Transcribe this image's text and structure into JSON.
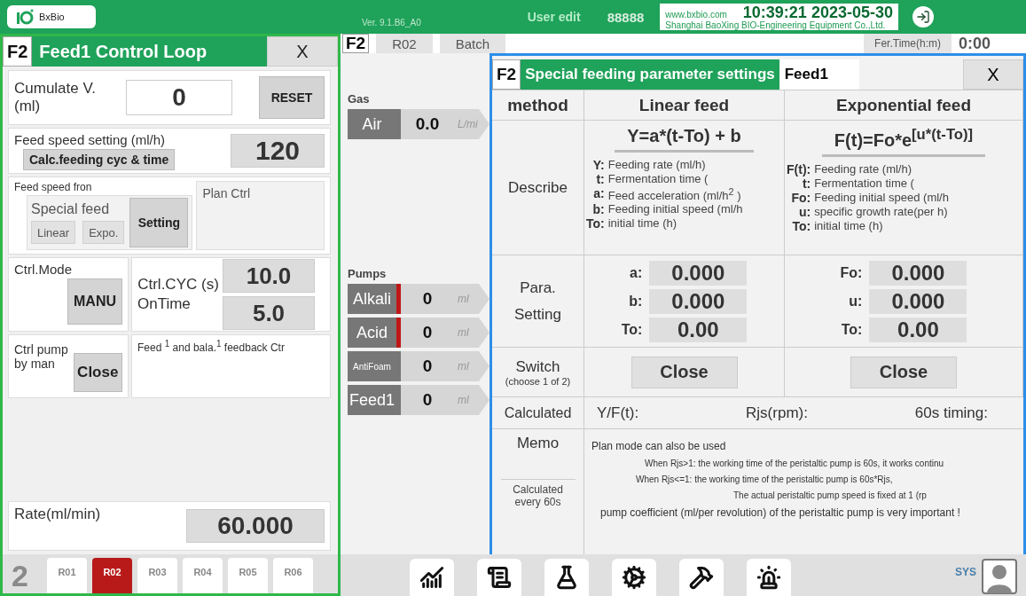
{
  "top_bar": {
    "brand": "BxBio",
    "version": "Ver. 9.1.B6_A0",
    "user": "User edit",
    "code": "88888",
    "website": "www.bxbio.com",
    "company": "Shanghai BaoXing BIO-Engineering Equipment Co.,Ltd.",
    "clock": "10:39:21 2023-05-30"
  },
  "feed_dialog": {
    "tag": "F2",
    "title": "Feed1 Control Loop",
    "close": "X",
    "cumulate": {
      "label": "Cumulate V. (ml)",
      "value": "0",
      "button": "RESET"
    },
    "speed": {
      "label": "Feed speed setting (ml/h)",
      "button": "Calc.feeding cyc & time",
      "value": "120"
    },
    "source": {
      "label": "Feed speed fron",
      "group": "Special feed",
      "options": [
        {
          "label": "Linear",
          "selected": false
        },
        {
          "label": "Expo.",
          "selected": false
        }
      ],
      "button": "Setting",
      "plan": "Plan Ctrl"
    },
    "mode": {
      "label": "Ctrl.Mode",
      "button": "MANU",
      "cycle_label": "Ctrl.CYC (s)",
      "cycle": "10.0",
      "ontime_label": "OnTime",
      "ontime": "5.0"
    },
    "manual": {
      "label": "Ctrl pump by man",
      "button": "Close",
      "feedback": "Feed $^{1}$ and bala.$^{1}$ feedback Ctr"
    },
    "rate": {
      "label": "Rate(ml/min)",
      "value": "60.000"
    }
  },
  "middle": {
    "tag": "F2",
    "tabs": [
      "R02",
      "Batch"
    ],
    "timer_label": "Fer.Time(h:m)",
    "timer": "0:00",
    "gas": {
      "title": "Gas",
      "rows": [
        {
          "label": "Air",
          "value": "0.0",
          "unit": "L/mi",
          "on": false
        }
      ]
    },
    "pumps": {
      "title": "Pumps",
      "rows": [
        {
          "label": "Alkali",
          "value": "0",
          "unit": "ml",
          "on": true
        },
        {
          "label": "Acid",
          "value": "0",
          "unit": "ml",
          "on": true
        },
        {
          "label": "AntiFoam",
          "value": "0",
          "unit": "ml",
          "on": false
        },
        {
          "label": "Feed1",
          "value": "0",
          "unit": "ml",
          "on": false
        }
      ]
    }
  },
  "special_dialog": {
    "tag": "F2",
    "title": "Special feeding parameter settings",
    "feed": "Feed1",
    "close": "X",
    "method_label": "method",
    "describe_label": "Describe",
    "para_label": "Para. Setting",
    "switch_label": "Switch",
    "switch_hint": "(choose 1 of 2)",
    "calc_label": "Calculated",
    "methods": [
      {
        "name": "Linear feed",
        "formula": "Y=a*(t-To) + b",
        "terms": [
          {
            "key": "Y:",
            "text": "Feeding rate (ml/h)"
          },
          {
            "key": "t:",
            "text": "Fermentation time ("
          },
          {
            "key": "a:",
            "text": "Feed acceleration (ml/h$^{2}$ )"
          },
          {
            "key": "b:",
            "text": "Feeding initial speed (ml/h"
          },
          {
            "key": "To:",
            "text": "initial time (h)"
          }
        ],
        "params": [
          {
            "key": "a:",
            "value": "0.000"
          },
          {
            "key": "b:",
            "value": "0.000"
          },
          {
            "key": "To:",
            "value": "0.00"
          }
        ],
        "switch": "Close"
      },
      {
        "name": "Exponential feed",
        "formula": "F(t)=Fo*e$^{[u*(t-To)]}$",
        "terms": [
          {
            "key": "F(t):",
            "text": "Feeding rate (ml/h)"
          },
          {
            "key": "t:",
            "text": "Fermentation time ("
          },
          {
            "key": "Fo:",
            "text": "Feeding initial speed (ml/h"
          },
          {
            "key": "u:",
            "text": "specific growth rate(per h)"
          },
          {
            "key": "To:",
            "text": "initial time (h)"
          }
        ],
        "params": [
          {
            "key": "Fo:",
            "value": "0.000"
          },
          {
            "key": "u:",
            "value": "0.000"
          },
          {
            "key": "To:",
            "value": "0.00"
          }
        ],
        "switch": "Close"
      }
    ],
    "calculated": [
      "Y/F(t):",
      "Rjs(rpm):",
      "60s timing:"
    ],
    "memo_label": "Memo",
    "memo_note": "Calculated every 60s",
    "memo_lines": [
      "Plan mode can also be used",
      "When Rjs>1: the working time of the peristaltic pump is 60s, it works continu",
      "When Rjs<=1: the working time of the peristaltic pump is 60s*Rjs,",
      "The actual peristaltic pump speed is fixed at 1 (rp",
      "pump coefficient (ml/per revolution) of the peristaltic pump is very important !"
    ]
  },
  "reactors": {
    "number": "2",
    "tabs": [
      {
        "label": "R01",
        "selected": false
      },
      {
        "label": "R02",
        "selected": true
      },
      {
        "label": "R03",
        "selected": false
      },
      {
        "label": "R04",
        "selected": false
      },
      {
        "label": "R05",
        "selected": false
      },
      {
        "label": "R06",
        "selected": false
      }
    ]
  },
  "user": {
    "label": "SYS"
  }
}
